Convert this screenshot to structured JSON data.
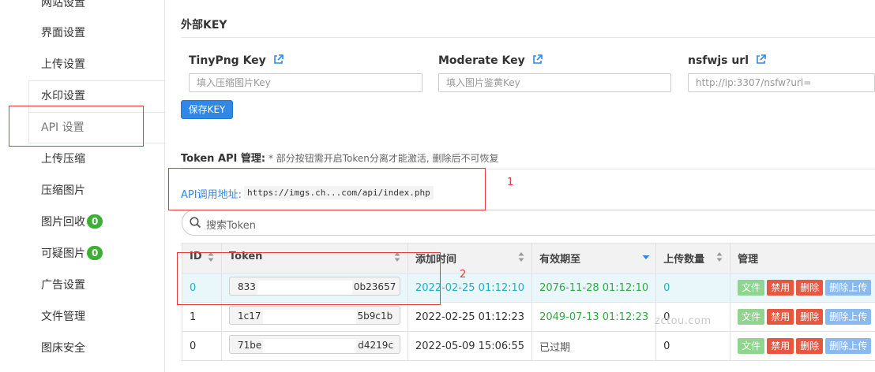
{
  "sidebar": {
    "items": [
      {
        "label": "网站设置"
      },
      {
        "label": "界面设置"
      },
      {
        "label": "上传设置"
      },
      {
        "label": "水印设置"
      },
      {
        "label": "API 设置"
      },
      {
        "label": "上传压缩"
      },
      {
        "label": "压缩图片"
      },
      {
        "label": "图片回收",
        "badge": "0"
      },
      {
        "label": "可疑图片",
        "badge": "0"
      },
      {
        "label": "广告设置"
      },
      {
        "label": "文件管理"
      },
      {
        "label": "图床安全"
      }
    ]
  },
  "external_key": {
    "title": "外部KEY",
    "fields": [
      {
        "label": "TinyPng Key",
        "placeholder": "填入压缩图片Key"
      },
      {
        "label": "Moderate Key",
        "placeholder": "填入图片鉴黄Key"
      },
      {
        "label": "nsfwjs url",
        "placeholder": "http://ip:3307/nsfw?url="
      }
    ],
    "save_label": "保存KEY"
  },
  "token_api": {
    "title": "Token API 管理:",
    "note": "* 部分按钮需开启Token分离才能激活, 删除后不可恢复",
    "url_label": "API调用地址:",
    "url": "https://imgs.ch...com/api/index.php",
    "search_placeholder": "搜索Token"
  },
  "table": {
    "headers": [
      "ID",
      "Token",
      "添加时间",
      "有效期至",
      "上传数量",
      "管理"
    ],
    "rows": [
      {
        "id": "0",
        "token_start": "833",
        "token_end": "0b23657",
        "added": "2022-02-25 01:12:10",
        "expires": "2076-11-28 01:12:10",
        "count": "0"
      },
      {
        "id": "1",
        "token_start": "1c17",
        "token_end": "5b9c1b",
        "added": "2022-02-25 01:12:23",
        "expires": "2049-07-13 01:12:23",
        "count": "0"
      },
      {
        "id": "0",
        "token_start": "71be",
        "token_end": "d4219c",
        "added": "2022-05-09 15:06:55",
        "expires": "已过期",
        "count": "0"
      }
    ],
    "actions": {
      "file": "文件",
      "ban": "禁用",
      "delete": "删除",
      "delete_uploads": "删除上传"
    }
  },
  "annotations": [
    "1",
    "2"
  ],
  "watermark": "zctou.com",
  "colors": {
    "accent": "#2f88e8",
    "annotation": "#e23b3b",
    "badge": "#3cb034",
    "teal": "#1bb0c2",
    "green": "#2eaa3f"
  }
}
